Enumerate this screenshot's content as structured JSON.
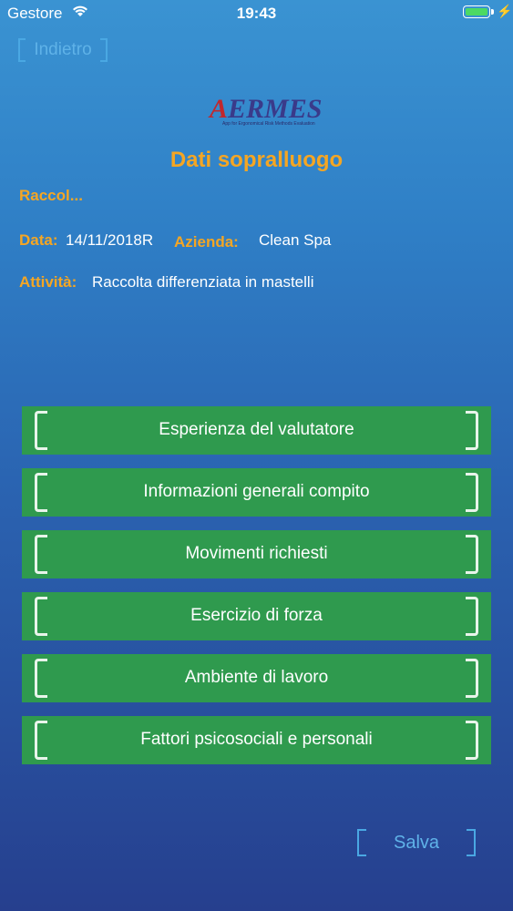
{
  "status_bar": {
    "carrier": "Gestore",
    "time": "19:43",
    "wifi_icon": "wifi-icon",
    "battery_icon": "battery-charging-icon"
  },
  "nav": {
    "back_label": "Indietro"
  },
  "logo": {
    "text_a": "A",
    "text_rest": "ERMES",
    "subtitle": "App for Ergonomical Risk Methods Evaluation"
  },
  "header": {
    "title": "Dati sopralluogo"
  },
  "info": {
    "task_name": "Raccol...",
    "date_label": "Data:",
    "date_value": "14/11/2018R",
    "company_label": "Azienda:",
    "company_value": "Clean Spa",
    "activity_label": "Attività:",
    "activity_value": "Raccolta differenziata in mastelli"
  },
  "sections": [
    {
      "label": "Esperienza del valutatore"
    },
    {
      "label": "Informazioni generali compito"
    },
    {
      "label": "Movimenti richiesti"
    },
    {
      "label": "Esercizio di forza"
    },
    {
      "label": "Ambiente di lavoro"
    },
    {
      "label": "Fattori psicosociali e personali"
    }
  ],
  "footer": {
    "save_label": "Salva"
  },
  "colors": {
    "accent_orange": "#f5a623",
    "button_green": "#2f9a4e",
    "link_blue": "#5fb2e8",
    "battery_green": "#4cd964"
  }
}
